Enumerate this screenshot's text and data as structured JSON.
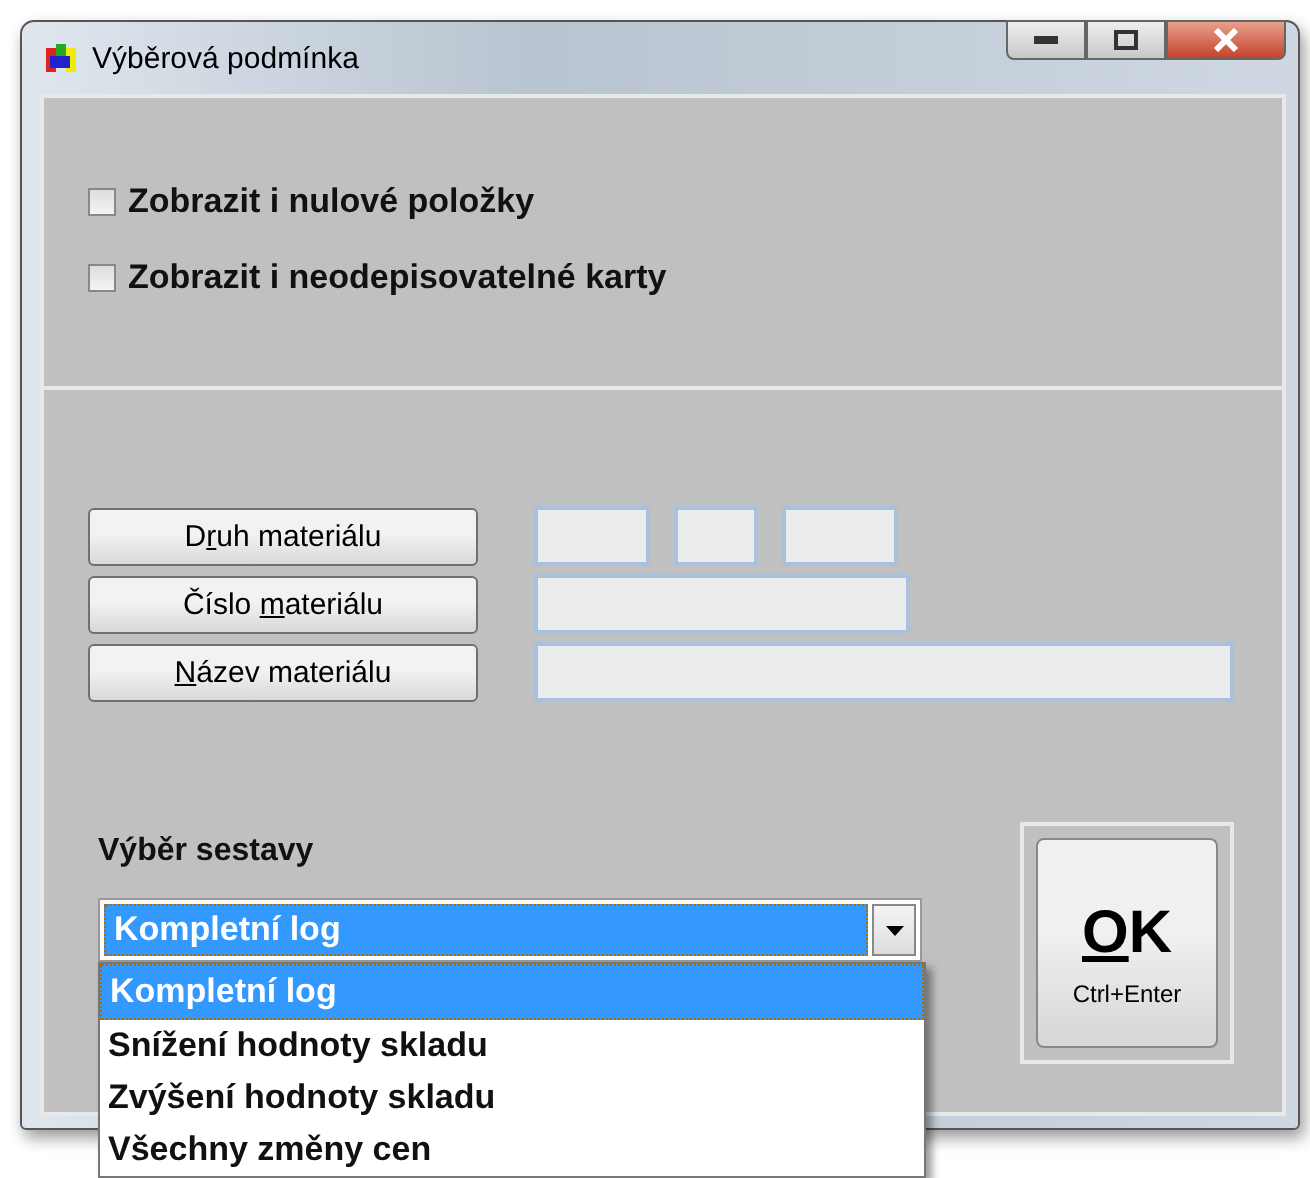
{
  "window": {
    "title": "Výběrová podmínka"
  },
  "options": [
    {
      "label": "Zobrazit i nulové položky",
      "checked": false
    },
    {
      "label": "Zobrazit i neodepisovatelné karty",
      "checked": false
    }
  ],
  "material_filters": [
    {
      "button": {
        "pre": "D",
        "key": "r",
        "post": "uh materiálu"
      },
      "fields": [
        {
          "kind": "short"
        },
        {
          "kind": "tiny"
        },
        {
          "kind": "short"
        }
      ]
    },
    {
      "button": {
        "pre": "Číslo ",
        "key": "m",
        "post": "ateriálu"
      },
      "fields": [
        {
          "kind": "medium"
        }
      ]
    },
    {
      "button": {
        "key": "N",
        "post": "ázev materiálu"
      },
      "fields": [
        {
          "kind": "wide"
        }
      ]
    }
  ],
  "report": {
    "label": "Výběr sestavy",
    "value": "Kompletní log",
    "expanded": true,
    "options": [
      {
        "label": "Kompletní log",
        "selected": true
      },
      {
        "label": "Snížení hodnoty skladu",
        "selected": false
      },
      {
        "label": "Zvýšení hodnoty skladu",
        "selected": false
      },
      {
        "label": "Všechny změny cen",
        "selected": false
      }
    ]
  },
  "ok_button": {
    "key": "O",
    "post": "K",
    "shortcut": "Ctrl+Enter"
  }
}
